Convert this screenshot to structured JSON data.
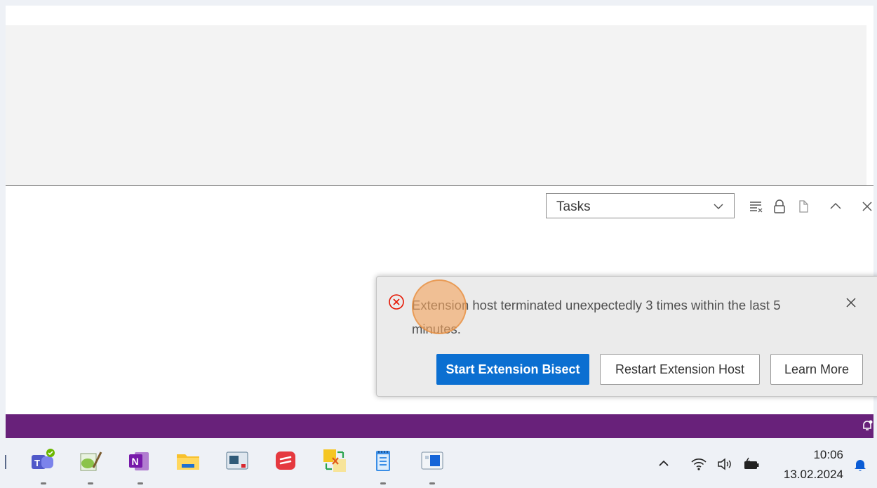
{
  "panel": {
    "task_selector_value": "Tasks"
  },
  "notification": {
    "severity": "error",
    "message": "Extension host terminated unexpectedly 3 times within the last 5 minutes.",
    "buttons": {
      "bisect": "Start Extension Bisect",
      "restart": "Restart Extension Host",
      "learn_more": "Learn More"
    }
  },
  "taskbar": {
    "apps": [
      "teams-icon",
      "notepad-plus-icon",
      "onenote-icon",
      "file-explorer-icon",
      "app-window-icon",
      "red-app-icon",
      "git-compare-icon",
      "notepad-icon",
      "remote-desktop-icon"
    ],
    "tray": [
      "chevron-up-icon",
      "wifi-icon",
      "speaker-icon",
      "battery-icon"
    ],
    "clock": {
      "time": "10:06",
      "date": "13.02.2024"
    }
  },
  "colors": {
    "status_bar": "#68217a",
    "primary_button": "#0b6fd1",
    "error_icon": "#e51400",
    "click_highlight": "#f4a460"
  }
}
